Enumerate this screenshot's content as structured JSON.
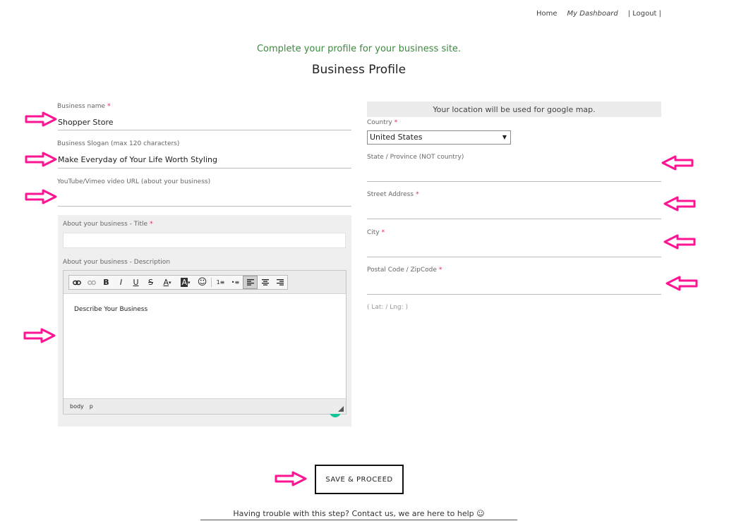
{
  "nav": {
    "home": "Home",
    "dashboard": "My Dashboard",
    "logout": "| Logout |"
  },
  "header": {
    "subtitle": "Complete your profile for your business site.",
    "title": "Business Profile"
  },
  "form_left": {
    "business_name": {
      "label": "Business name",
      "required": "*",
      "value": "Shopper Store"
    },
    "slogan": {
      "label": "Business Slogan (max 120 characters)",
      "value": "Make Everyday of Your Life Worth Styling"
    },
    "video": {
      "label": "YouTube/Vimeo video URL (about your business)",
      "value": ""
    },
    "about": {
      "title_label": "About your business - Title",
      "title_required": "*",
      "title_value": "",
      "desc_label": "About your business - Description",
      "desc_text": "Describe Your Business",
      "path": [
        "body",
        "p"
      ],
      "toolbar": {
        "bold": "B",
        "italic": "I",
        "underline": "U",
        "strike": "S",
        "font_color": "A",
        "highlight": "A",
        "emoji": "☺",
        "numbered_list": "1≡",
        "bullet_list": "•≡",
        "align_left": "≡",
        "align_center": "≡",
        "align_right": "≡"
      },
      "grammarly_badge": "G"
    }
  },
  "form_right": {
    "map_note": "Your location will be used for google map.",
    "country": {
      "label": "Country",
      "required": "*",
      "value": "United States"
    },
    "state": {
      "label": "State / Province (NOT country)",
      "value": ""
    },
    "street": {
      "label": "Street Address",
      "required": "*",
      "value": ""
    },
    "city": {
      "label": "City",
      "required": "*",
      "value": ""
    },
    "postal": {
      "label": "Postal Code / ZipCode",
      "required": "*",
      "value": ""
    },
    "latlng": "( Lat: / Lng: )"
  },
  "actions": {
    "save": "SAVE & PROCEED",
    "help_prefix": "Having trouble with this step? ",
    "help_link": "Contact us, we are here to help",
    "help_suffix": " ☺"
  },
  "colors": {
    "subtitle_green": "#3b8a3e",
    "required_red": "#e0245e",
    "arrow_pink": "#ff1493",
    "grammarly_green": "#15c39a"
  }
}
